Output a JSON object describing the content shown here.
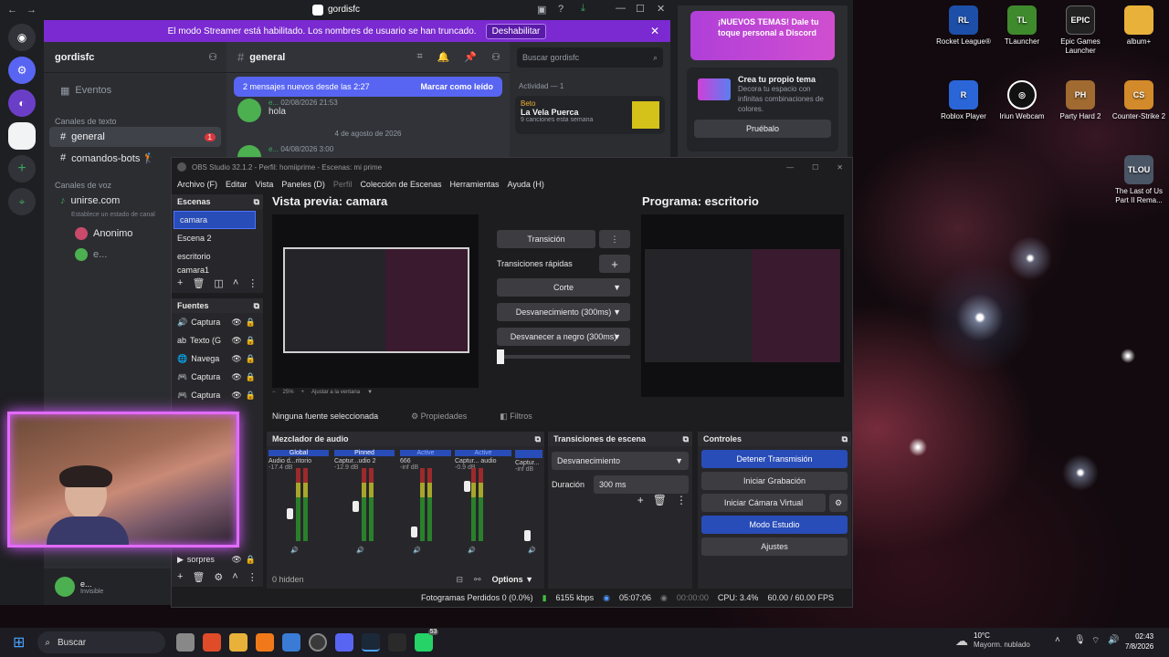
{
  "desktop": {
    "icons": [
      {
        "label": "Rocket League®",
        "color": "#1e4fa8",
        "glyph": "RL"
      },
      {
        "label": "TLauncher",
        "color": "#3f8a2d",
        "glyph": "TL"
      },
      {
        "label": "Epic Games Launcher",
        "color": "#222",
        "glyph": "EPIC"
      },
      {
        "label": "album+",
        "color": "#e8b23a",
        "glyph": ""
      },
      {
        "label": "Roblox Player",
        "color": "#2b66d9",
        "glyph": "R"
      },
      {
        "label": "Iriun Webcam",
        "color": "#111",
        "glyph": "◎"
      },
      {
        "label": "Party Hard 2",
        "color": "#a06a30",
        "glyph": "PH"
      },
      {
        "label": "Counter-Strike 2",
        "color": "#d28a2a",
        "glyph": "CS"
      },
      {
        "label": "The Last of Us Part II Rema...",
        "color": "#4a5566",
        "glyph": "TLOU"
      }
    ]
  },
  "discord": {
    "title": "gordisfc",
    "banner": {
      "text": "El modo Streamer está habilitado. Los nombres de usuario se han truncado.",
      "button": "Deshabilitar"
    },
    "server_name": "gordisfc",
    "events_label": "Eventos",
    "text_category": "Canales de texto",
    "text_channels": [
      {
        "name": "general",
        "badge": "1"
      },
      {
        "name": "comandos-bots 🏌"
      }
    ],
    "voice_category": "Canales de voz",
    "voice_channel": "unirse.com",
    "voice_status": "Establece un estado de canal",
    "voice_users": [
      "Anonimo",
      "e..."
    ],
    "current_channel": "general",
    "search_placeholder": "Buscar gordisfc",
    "new_messages": {
      "text": "2 mensajes nuevos desde las 2:27",
      "action": "Marcar como leído"
    },
    "messages": [
      {
        "user": "e...",
        "time": "02/08/2026 21:53",
        "text": "hola"
      },
      {
        "user": "e...",
        "time": "04/08/2026 3:00",
        "text": ""
      }
    ],
    "date_divider": "4 de agosto de 2026",
    "activity": {
      "header": "Actividad — 1",
      "user": "Beto",
      "title": "La Vela Puerca",
      "subtitle": "9 canciones esta semana"
    },
    "promo": {
      "title": "¡NUEVOS TEMAS! Dale tu toque personal a Discord"
    },
    "theme_card": {
      "title": "Crea tu propio tema",
      "desc": "Decora tu espacio con infinitas combinaciones de colores.",
      "button": "Pruébalo"
    },
    "user_panel": {
      "name": "e...",
      "status": "Invisible"
    }
  },
  "obs": {
    "title": "OBS Studio 32.1.2 - Perfil: homiiprime - Escenas: mi prime",
    "menu": [
      "Archivo (F)",
      "Editar",
      "Vista",
      "Paneles (D)",
      "Perfil",
      "Colección de Escenas",
      "Herramientas",
      "Ayuda (H)"
    ],
    "scenes_title": "Escenas",
    "scenes": [
      "camara",
      "Escena 2",
      "escritorio",
      "camara1"
    ],
    "sources_title": "Fuentes",
    "sources": [
      "Captura",
      "Texto (G",
      "Navega",
      "Captura",
      "Captura",
      "sorpres"
    ],
    "preview_title": "Vista previa: camara",
    "program_title": "Programa: escritorio",
    "transition_btn": "Transición",
    "quick_transitions": "Transiciones rápidas",
    "quick_list": [
      "Corte",
      "Desvanecimiento (300ms)",
      "Desvanecer a negro (300ms)"
    ],
    "zoom": "25%",
    "fit": "Ajustar a la ventana",
    "no_source": "Ninguna fuente seleccionada",
    "properties": "Propiedades",
    "filters": "Filtros",
    "mixer_title": "Mezclador de audio",
    "mixer_channels": [
      {
        "tag": "Global",
        "name": "Audio d...ritorio",
        "db": "-17.4 dB"
      },
      {
        "tag": "Pinned",
        "name": "Captur...udio 2",
        "db": "-12.9 dB"
      },
      {
        "tag": "Active",
        "name": "666",
        "db": "-inf dB"
      },
      {
        "tag": "Active",
        "name": "Captur... audio",
        "db": "-0.9 dB"
      },
      {
        "tag": "",
        "name": "Captur...",
        "db": "-inf dB"
      }
    ],
    "meter_scale": [
      "0",
      "-6",
      "-12",
      "-18",
      "-24",
      "-30",
      "-36",
      "-42",
      "-48",
      "-54",
      "-60"
    ],
    "hidden": "0 hidden",
    "options": "Options",
    "transitions_title": "Transiciones de escena",
    "transition_type": "Desvanecimiento",
    "duration_label": "Duración",
    "duration_value": "300 ms",
    "controls_title": "Controles",
    "controls": [
      {
        "label": "Detener Transmisión",
        "active": true
      },
      {
        "label": "Iniciar Grabación",
        "active": false
      },
      {
        "label": "Iniciar Cámara Virtual",
        "active": false
      },
      {
        "label": "Modo Estudio",
        "active": true
      },
      {
        "label": "Ajustes",
        "active": false
      }
    ],
    "status": {
      "dropped": "Fotogramas Perdidos 0 (0.0%)",
      "bitrate": "6155 kbps",
      "stream_time": "05:07:06",
      "rec_time": "00:00:00",
      "cpu": "CPU: 3.4%",
      "fps": "60.00 / 60.00 FPS"
    }
  },
  "taskbar": {
    "search": "Buscar",
    "weather_temp": "10°C",
    "weather_desc": "Mayorm. nublado",
    "time": "02:43",
    "date": "7/8/2026",
    "badge": "53"
  }
}
